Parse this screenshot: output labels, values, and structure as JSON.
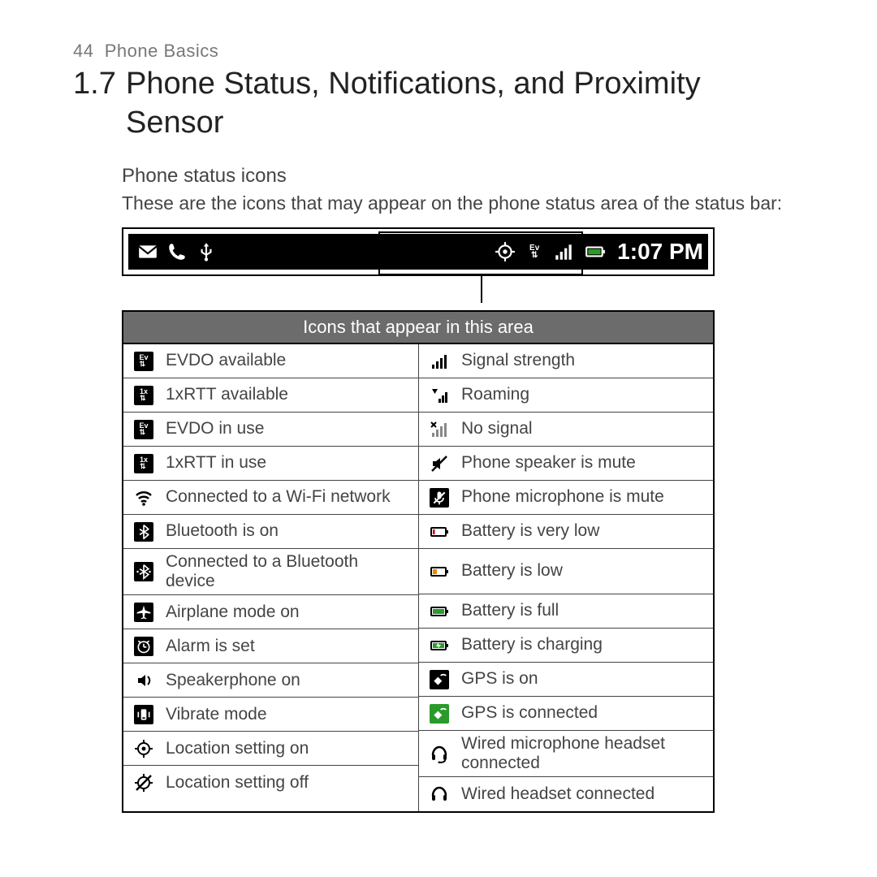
{
  "page_number": "44",
  "running_head": "Phone Basics",
  "section_number": "1.7",
  "section_title": "Phone Status, Notifications, and Proximity Sensor",
  "subhead": "Phone status icons",
  "intro": "These are the icons that may appear on the phone status area of the status bar:",
  "statusbar": {
    "time": "1:07 PM",
    "left_icons": [
      "mail-icon",
      "phone-icon",
      "usb-icon"
    ],
    "right_icons": [
      "location-icon",
      "evdo-icon",
      "signal-icon",
      "battery-icon"
    ]
  },
  "table": {
    "header": "Icons that appear in this area",
    "left": [
      {
        "icon": "evdo-available-icon",
        "label": "EVDO available"
      },
      {
        "icon": "onexrtt-available-icon",
        "label": "1xRTT available"
      },
      {
        "icon": "evdo-inuse-icon",
        "label": "EVDO in use"
      },
      {
        "icon": "onexrtt-inuse-icon",
        "label": "1xRTT in use"
      },
      {
        "icon": "wifi-icon",
        "label": "Connected to a Wi-Fi network"
      },
      {
        "icon": "bluetooth-on-icon",
        "label": "Bluetooth is on"
      },
      {
        "icon": "bluetooth-connected-icon",
        "label": "Connected to a Bluetooth device",
        "tall": true
      },
      {
        "icon": "airplane-icon",
        "label": "Airplane mode on"
      },
      {
        "icon": "alarm-icon",
        "label": "Alarm is set"
      },
      {
        "icon": "speakerphone-icon",
        "label": "Speakerphone on"
      },
      {
        "icon": "vibrate-icon",
        "label": "Vibrate mode"
      },
      {
        "icon": "location-on-icon",
        "label": "Location setting on"
      },
      {
        "icon": "location-off-icon",
        "label": "Location setting off"
      }
    ],
    "right": [
      {
        "icon": "signal-strength-icon",
        "label": "Signal strength"
      },
      {
        "icon": "roaming-icon",
        "label": "Roaming"
      },
      {
        "icon": "no-signal-icon",
        "label": "No signal"
      },
      {
        "icon": "speaker-mute-icon",
        "label": "Phone speaker is mute"
      },
      {
        "icon": "mic-mute-icon",
        "label": "Phone microphone is mute"
      },
      {
        "icon": "battery-verylow-icon",
        "label": "Battery is very low"
      },
      {
        "icon": "battery-low-icon",
        "label": "Battery is low",
        "tall": true
      },
      {
        "icon": "battery-full-icon",
        "label": "Battery is full"
      },
      {
        "icon": "battery-charging-icon",
        "label": "Battery is charging"
      },
      {
        "icon": "gps-on-icon",
        "label": "GPS is on"
      },
      {
        "icon": "gps-connected-icon",
        "label": "GPS is connected"
      },
      {
        "icon": "headset-mic-icon",
        "label": "Wired microphone headset connected",
        "tall": true
      },
      {
        "icon": "headset-icon",
        "label": "Wired headset connected"
      }
    ]
  }
}
